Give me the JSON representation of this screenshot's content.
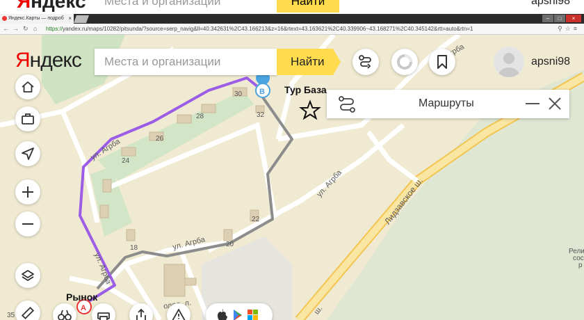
{
  "ghost_header": {
    "logo_first": "Я",
    "logo_rest": "ндекс",
    "search_placeholder": "Места и организации",
    "find_label": "Найти",
    "username": "apsni98"
  },
  "browser": {
    "tab_title": "Яндекс.Карты — подроб",
    "tab_close": "×",
    "window_buttons": [
      "–",
      "□",
      "×"
    ],
    "url_scheme": "https://",
    "url_host": "yandex.ru",
    "url_path": "/maps/10282/pitsunda/?source=serp_navig&ll=40.342631%2C43.166213&z=16&rtext=43.163621%2C40.339906~43.168271%2C40.345142&rtt=auto&rtn=1"
  },
  "header": {
    "logo_first": "Я",
    "logo_rest": "ндекс",
    "search_placeholder": "Места и организации",
    "find_label": "Найти",
    "username": "apsni98"
  },
  "routes_panel": {
    "title": "Маршруты"
  },
  "map": {
    "place_tur_baza": "Тур База",
    "place_rynok": "Рынок",
    "marker_a": "A",
    "marker_b": "B",
    "streets": {
      "agrba_top": "грба",
      "agrba_left": "ул. Агрба",
      "agrba_mid": "ул. Агрба",
      "agrba_bottom": "ул. Агрба",
      "agrba_vertical": "ул. Агрба",
      "lidzava": "Лидзавское ш.",
      "sh_bottom": "ш.",
      "other": "олее..л."
    },
    "building_numbers": [
      "30",
      "32",
      "28",
      "26",
      "24",
      "22",
      "20",
      "18",
      "35"
    ],
    "relic_text": [
      "Рели",
      "сос",
      "р"
    ],
    "colors": {
      "route_main": "#9b5de5",
      "route_alt": "#8c8c8c",
      "land": "#f0ead2",
      "forest": "#dfe7d2",
      "highway": "#f5d77a"
    }
  }
}
